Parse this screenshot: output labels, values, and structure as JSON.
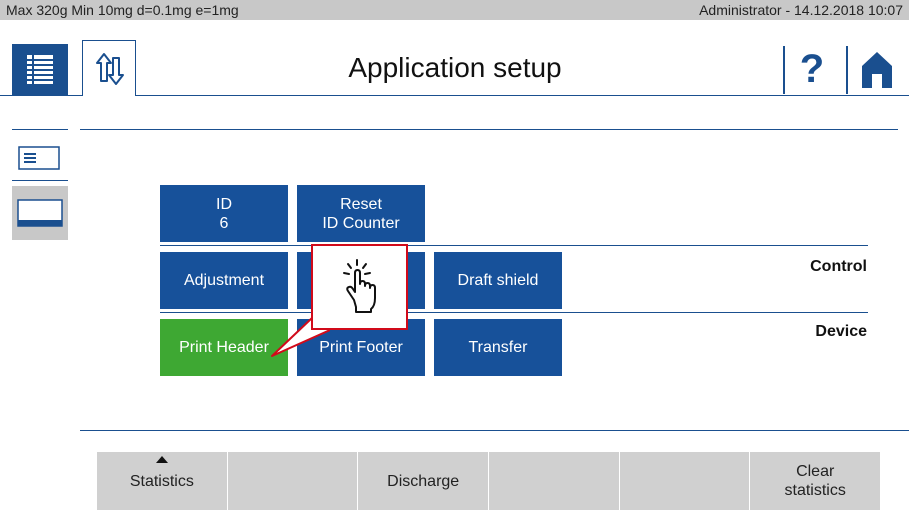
{
  "status_bar": {
    "left": "Max 320g  Min 10mg  d=0.1mg  e=1mg",
    "right": "Administrator  -  14.12.2018 10:07"
  },
  "header": {
    "title": "Application setup",
    "help": "?"
  },
  "tiles": {
    "id": "ID\n6",
    "reset_id_counter": "Reset\nID Counter",
    "adjustment": "Adjustment",
    "draft_shield": "Draft shield",
    "print_header": "Print Header",
    "print_footer": "Print Footer",
    "transfer": "Transfer"
  },
  "sections": {
    "control": "Control",
    "device": "Device"
  },
  "softkeys": [
    {
      "label": "Statistics"
    },
    {
      "label": ""
    },
    {
      "label": "Discharge"
    },
    {
      "label": ""
    },
    {
      "label": ""
    },
    {
      "label": "Clear\nstatistics"
    }
  ],
  "colors": {
    "primary": "#17519a",
    "active": "#3ea833",
    "callout": "#d10a1a"
  },
  "icons": {
    "menu": "list-icon",
    "tab": "up-down-arrows-icon",
    "home": "home-icon",
    "pointer": "tap-hand-icon"
  }
}
